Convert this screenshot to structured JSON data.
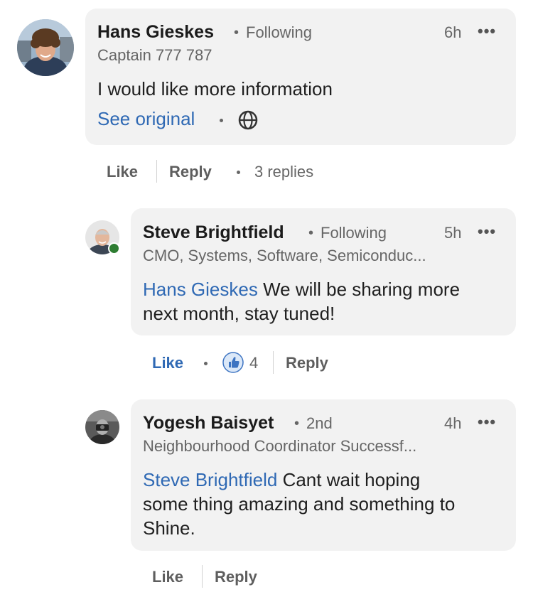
{
  "comments": [
    {
      "author": "Hans Gieskes",
      "relation": "Following",
      "time": "6h",
      "headline": "Captain 777 787",
      "text": "I would like more information",
      "see_original": "See original",
      "actions": {
        "like": "Like",
        "reply": "Reply",
        "replies": "3 replies"
      }
    },
    {
      "author": "Steve Brightfield",
      "relation": "Following",
      "time": "5h",
      "headline": "CMO, Systems, Software, Semiconduc...",
      "mention": "Hans Gieskes",
      "text_line1": "We will be sharing more",
      "text_line2": "next month, stay tuned!",
      "reaction_count": "4",
      "actions": {
        "like": "Like",
        "reply": "Reply"
      }
    },
    {
      "author": "Yogesh Baisyet",
      "relation": "2nd",
      "time": "4h",
      "headline": "Neighbourhood Coordinator Successf...",
      "mention": "Steve Brightfield",
      "text_line1": "Cant wait hoping",
      "text_line2": "some thing amazing and something to",
      "text_line3": "Shine.",
      "actions": {
        "like": "Like",
        "reply": "Reply"
      }
    }
  ],
  "colors": {
    "link": "#2f69b4",
    "bubble": "#f2f2f2",
    "online": "#2e7d32"
  },
  "icons": {
    "more": "more-icon",
    "globe": "globe-icon",
    "like_reaction": "like-reaction-icon"
  }
}
